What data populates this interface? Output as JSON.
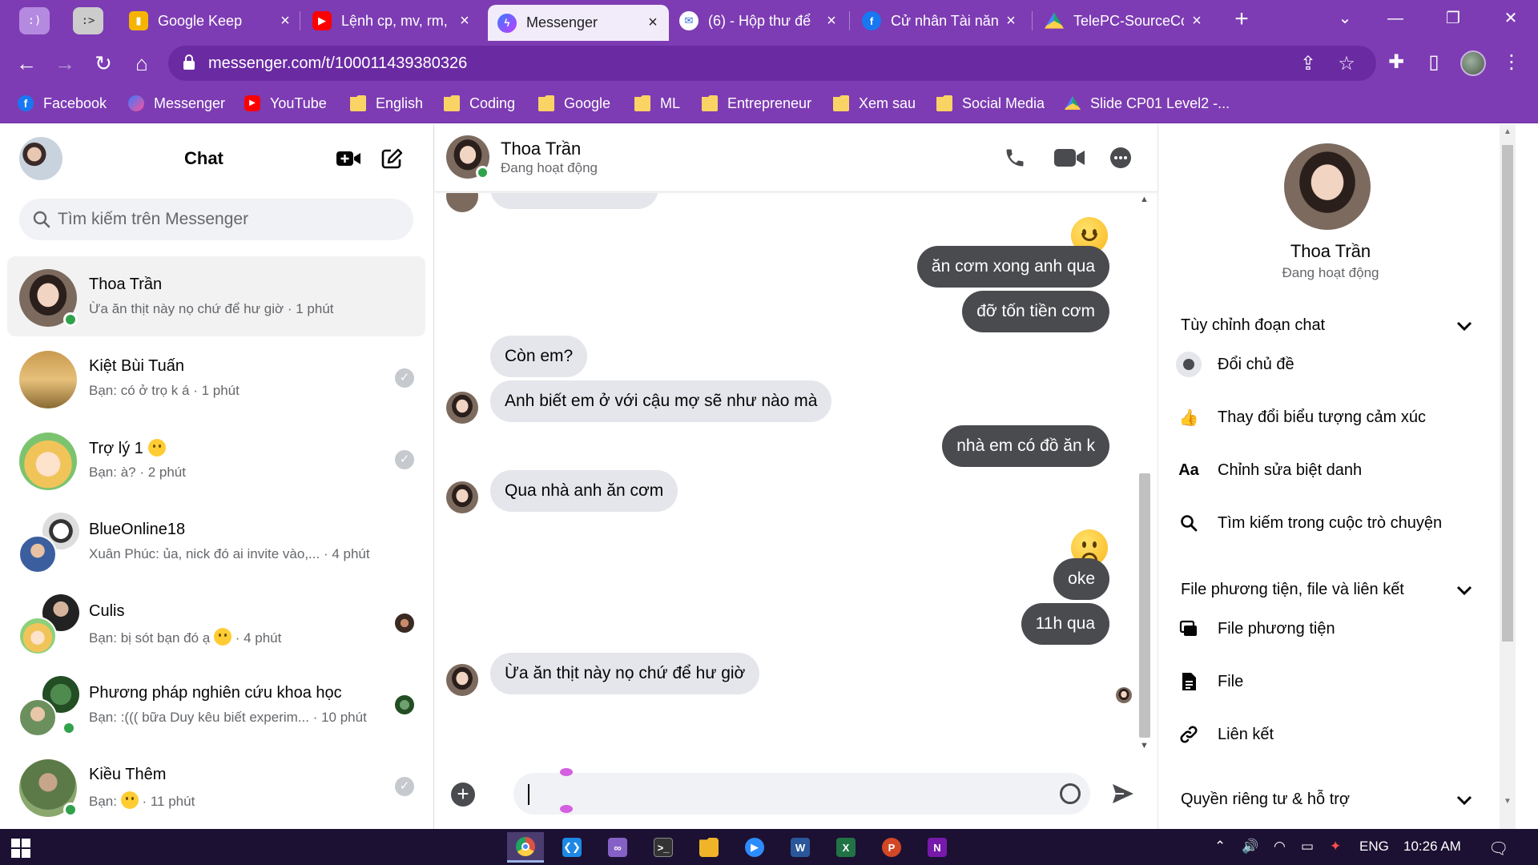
{
  "browser": {
    "pinned_tabs": [
      ":)",
      ":>"
    ],
    "tabs": [
      {
        "title": "Google Keep",
        "icon": "google-keep-icon",
        "color": "#f5b400"
      },
      {
        "title": "Lệnh cp, mv, rm,",
        "icon": "youtube-icon",
        "color": "#ff0000"
      },
      {
        "title": "Messenger",
        "icon": "messenger-icon",
        "color": "#a033ff"
      },
      {
        "title": "(6) - Hộp thư để",
        "icon": "mail-icon",
        "color": "#2e6bd9"
      },
      {
        "title": "Cử nhân Tài năng",
        "icon": "facebook-icon",
        "color": "#1877f2"
      },
      {
        "title": "TelePC-SourceCo",
        "icon": "google-drive-icon",
        "color": "#1fa463"
      }
    ],
    "url": "messenger.com/t/100011439380326",
    "bookmarks": [
      {
        "label": "Facebook",
        "icon": "facebook-icon"
      },
      {
        "label": "Messenger",
        "icon": "messenger-icon"
      },
      {
        "label": "YouTube",
        "icon": "youtube-icon"
      },
      {
        "label": "English",
        "icon": "folder-icon"
      },
      {
        "label": "Coding",
        "icon": "folder-icon"
      },
      {
        "label": "Google",
        "icon": "folder-icon"
      },
      {
        "label": "ML",
        "icon": "folder-icon"
      },
      {
        "label": "Entrepreneur",
        "icon": "folder-icon"
      },
      {
        "label": "Xem sau",
        "icon": "folder-icon"
      },
      {
        "label": "Social Media",
        "icon": "folder-icon"
      },
      {
        "label": "Slide CP01 Level2 -...",
        "icon": "google-drive-icon"
      }
    ]
  },
  "sidebar": {
    "title": "Chat",
    "search_placeholder": "Tìm kiếm trên Messenger",
    "conversations": [
      {
        "name": "Thoa Trần",
        "preview": "Ừa ăn thịt này nọ chứ để hư giờ · 1 phút",
        "online": true,
        "status": "none"
      },
      {
        "name": "Kiệt Bùi Tuấn",
        "preview": "Bạn: có ở trọ k á · 1 phút",
        "online": false,
        "status": "seen-check"
      },
      {
        "name": "Trợ lý 1",
        "preview": "Bạn: à? · 2 phút",
        "online": false,
        "status": "seen-check"
      },
      {
        "name": "BlueOnline18",
        "preview": "Xuân Phúc: ủa, nick đó ai invite vào,... · 4 phút",
        "online": false,
        "status": "none"
      },
      {
        "name": "Culis",
        "preview_before": "Bạn: bị sót bạn đó ạ",
        "preview_after": "· 4 phút",
        "online": false,
        "status": "seen-avatar"
      },
      {
        "name": "Phương pháp nghiên cứu khoa học",
        "preview": "Bạn: :((( bữa Duy kêu biết experim... · 10 phút",
        "online": true,
        "status": "seen-avatar"
      },
      {
        "name": "Kiều Thêm",
        "preview_before": "Bạn:",
        "preview_after": "· 11 phút",
        "online": true,
        "status": "seen-check"
      }
    ]
  },
  "chat": {
    "name": "Thoa Trần",
    "status": "Đang hoạt động",
    "messages": [
      {
        "dir": "out",
        "text": "ăn cơm xong anh qua"
      },
      {
        "dir": "out",
        "text": "đỡ tốn tiền cơm"
      },
      {
        "dir": "in",
        "text": "Còn em?"
      },
      {
        "dir": "in",
        "text": "Anh biết em ở với cậu mợ sẽ như nào mà"
      },
      {
        "dir": "out",
        "text": "nhà em có đồ ăn k"
      },
      {
        "dir": "in",
        "text": "Qua nhà anh ăn cơm"
      },
      {
        "dir": "out",
        "text": "oke"
      },
      {
        "dir": "out",
        "text": "11h qua"
      },
      {
        "dir": "in",
        "text": "Ừa ăn thịt này nọ chứ để hư giờ"
      }
    ],
    "input_value": ""
  },
  "info": {
    "name": "Thoa Trần",
    "status": "Đang hoạt động",
    "sections": {
      "customize": "Tùy chỉnh đoạn chat",
      "media": "File phương tiện, file và liên kết",
      "privacy": "Quyền riêng tư & hỗ trợ"
    },
    "customize_items": [
      {
        "label": "Đổi chủ đề",
        "icon": "theme-icon"
      },
      {
        "label": "Thay đổi biểu tượng cảm xúc",
        "icon": "thumbs-up-icon"
      },
      {
        "label": "Chỉnh sửa biệt danh",
        "icon": "text-aa-icon",
        "glyph": "Aa"
      },
      {
        "label": "Tìm kiếm trong cuộc trò chuyện",
        "icon": "search-icon"
      }
    ],
    "media_items": [
      {
        "label": "File phương tiện",
        "icon": "media-icon"
      },
      {
        "label": "File",
        "icon": "file-icon"
      },
      {
        "label": "Liên kết",
        "icon": "link-icon"
      }
    ]
  },
  "taskbar": {
    "apps": [
      {
        "icon": "chrome-icon",
        "color": "#de5246",
        "label": ""
      },
      {
        "icon": "vscode-icon",
        "color": "#1e88e5",
        "label": ""
      },
      {
        "icon": "visual-studio-icon",
        "color": "#8661c5",
        "label": ""
      },
      {
        "icon": "terminal-icon",
        "color": "#333333",
        "label": ""
      },
      {
        "icon": "file-explorer-icon",
        "color": "#f0b429",
        "label": ""
      },
      {
        "icon": "zoom-icon",
        "color": "#2d8cff",
        "label": ""
      },
      {
        "icon": "word-icon",
        "color": "#2b579a",
        "label": "W"
      },
      {
        "icon": "excel-icon",
        "color": "#217346",
        "label": "X"
      },
      {
        "icon": "powerpoint-icon",
        "color": "#d24726",
        "label": "P"
      },
      {
        "icon": "onenote-icon",
        "color": "#7719aa",
        "label": "N"
      }
    ],
    "language": "ENG",
    "time": "10:26 AM"
  },
  "colors": {
    "browser_purple": "#7d3cb3",
    "outgoing_bubble": "#4a4b4f",
    "incoming_bubble": "#e4e6eb",
    "online_green": "#31a24c"
  }
}
